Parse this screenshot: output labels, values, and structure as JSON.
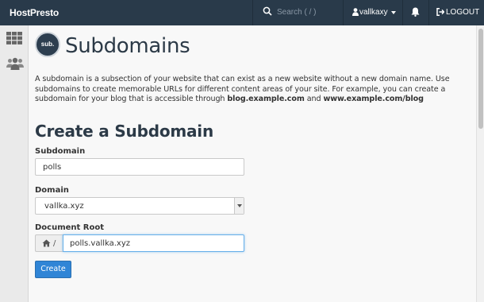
{
  "header": {
    "logo_main": "HostPresto",
    "search_placeholder": "Search ( / )",
    "username": "vallkaxy",
    "logout_label": "LOGOUT"
  },
  "page": {
    "badge_text": "sub.",
    "title": "Subdomains",
    "description": {
      "text": "A subdomain is a subsection of your website that can exist as a new website without a new domain name. Use subdomains to create memorable URLs for different content areas of your site. For example, you can create a subdomain for your blog that is accessible through ",
      "example1": "blog.example.com",
      "joiner": " and ",
      "example2": "www.example.com/blog"
    }
  },
  "form": {
    "section_title": "Create a Subdomain",
    "subdomain_label": "Subdomain",
    "subdomain_value": "polls",
    "domain_label": "Domain",
    "domain_value": "vallka.xyz",
    "docroot_label": "Document Root",
    "docroot_prefix": "/",
    "docroot_value": "polls.vallka.xyz",
    "create_label": "Create"
  },
  "icons": {
    "search": "search-icon",
    "user": "user-icon",
    "bell": "bell-icon",
    "logout": "logout-icon",
    "apps": "grid-icon",
    "users": "users-icon",
    "home": "home-icon"
  },
  "colors": {
    "topbar": "#293a4a",
    "accent": "#3085d6",
    "logo_accent": "#ff6c2c"
  }
}
